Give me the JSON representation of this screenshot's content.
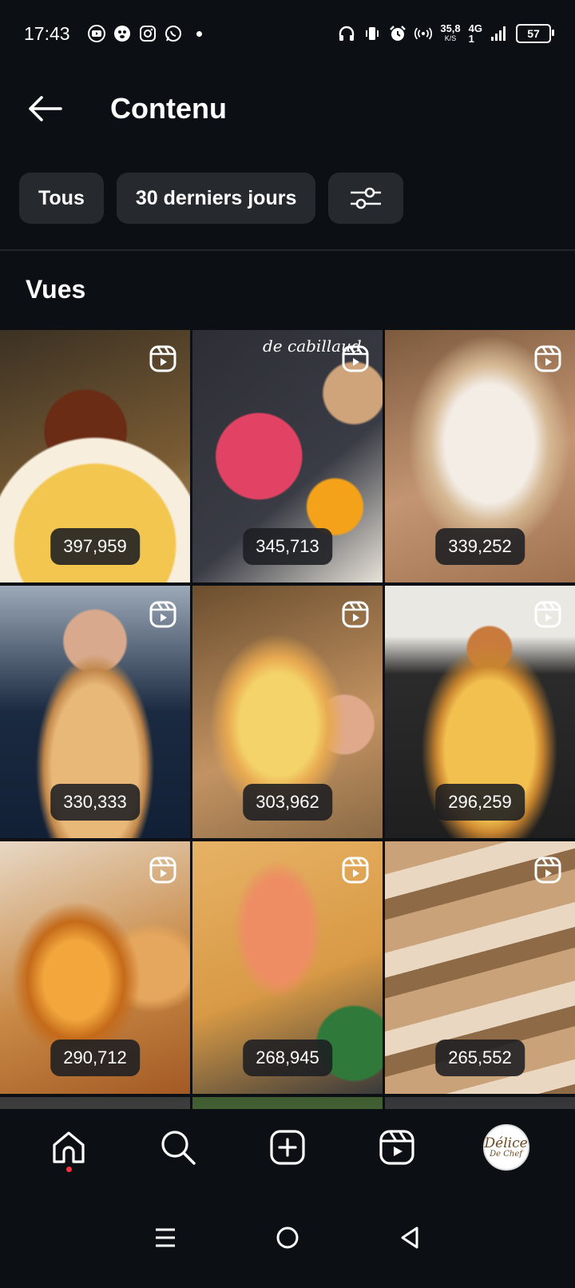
{
  "status_bar": {
    "time": "17:43",
    "net_speed_value": "35,8",
    "net_speed_unit": "K/S",
    "network_type": "4G",
    "network_sim": "1",
    "battery": "57",
    "left_icons": [
      "youtube-icon",
      "pawprint-app-icon",
      "instagram-icon",
      "whatsapp-icon",
      "notification-dot"
    ],
    "right_icons": [
      "headphones-icon",
      "vibrate-icon",
      "alarm-icon",
      "hotspot-icon",
      "signal-icon",
      "battery-icon"
    ]
  },
  "header": {
    "title": "Contenu",
    "back_icon": "arrow-left-icon"
  },
  "filters": {
    "all_label": "Tous",
    "period_label": "30 derniers jours",
    "settings_icon": "sliders-icon"
  },
  "section": {
    "title": "Vues"
  },
  "grid": {
    "items": [
      {
        "views": "397,959",
        "type_icon": "reels-icon"
      },
      {
        "views": "345,713",
        "type_icon": "reels-icon"
      },
      {
        "views": "339,252",
        "type_icon": "reels-icon"
      },
      {
        "views": "330,333",
        "type_icon": "reels-icon"
      },
      {
        "views": "303,962",
        "type_icon": "reels-icon"
      },
      {
        "views": "296,259",
        "type_icon": "reels-icon"
      },
      {
        "views": "290,712",
        "type_icon": "reels-icon"
      },
      {
        "views": "268,945",
        "type_icon": "reels-icon"
      },
      {
        "views": "265,552",
        "type_icon": "reels-icon"
      }
    ],
    "overlay_text": "de cabillaud"
  },
  "bottom_nav": {
    "items": [
      "home-icon",
      "search-icon",
      "create-icon",
      "reels-icon",
      "profile-avatar"
    ],
    "avatar_line1": "Délice",
    "avatar_line2": "De Chef"
  },
  "system_nav": {
    "items": [
      "recents-icon",
      "home-circle-icon",
      "back-triangle-icon"
    ]
  },
  "colors": {
    "background": "#0c1014",
    "chip": "#262a2f",
    "notification": "#ff3040"
  }
}
